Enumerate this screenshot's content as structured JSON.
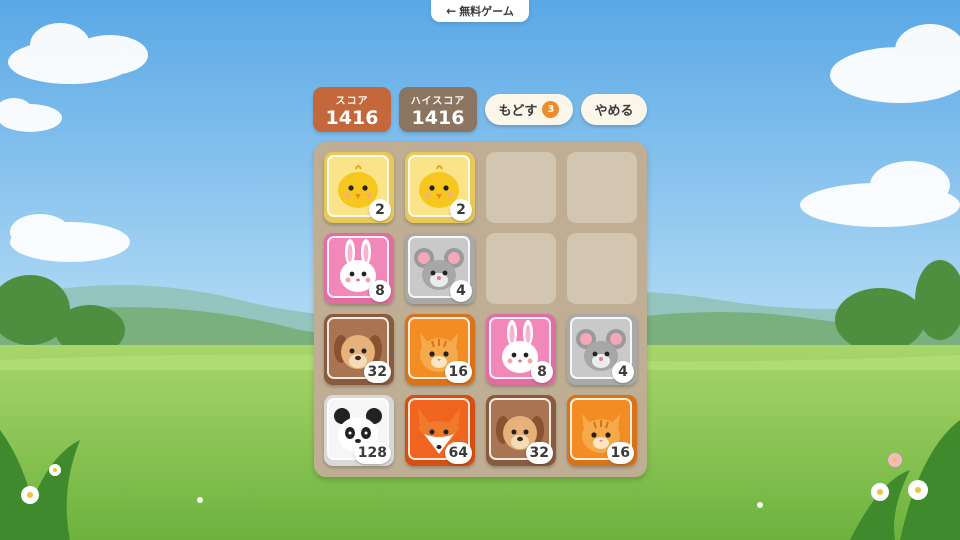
{
  "nav": {
    "back_label": "無料ゲーム",
    "back_icon": "left-arrow-icon"
  },
  "scores": {
    "score_label": "スコア",
    "score_value": "1416",
    "best_label": "ハイスコア",
    "best_value": "1416"
  },
  "controls": {
    "undo_label": "もどす",
    "undo_count": "3",
    "quit_label": "やめる"
  },
  "colors": {
    "score": "#c4673b",
    "best": "#8b7560",
    "board": "#bfae94",
    "empty_cell": "#d2c6b1",
    "undo_badge": "#ef8a2d"
  },
  "board": {
    "rows": [
      [
        {
          "value": "2",
          "animal": "chick"
        },
        {
          "value": "2",
          "animal": "chick"
        },
        null,
        null
      ],
      [
        {
          "value": "8",
          "animal": "rabbit"
        },
        {
          "value": "4",
          "animal": "mouse"
        },
        null,
        null
      ],
      [
        {
          "value": "32",
          "animal": "dog"
        },
        {
          "value": "16",
          "animal": "cat"
        },
        {
          "value": "8",
          "animal": "rabbit"
        },
        {
          "value": "4",
          "animal": "mouse"
        }
      ],
      [
        {
          "value": "128",
          "animal": "panda"
        },
        {
          "value": "64",
          "animal": "fox"
        },
        {
          "value": "32",
          "animal": "dog"
        },
        {
          "value": "16",
          "animal": "cat"
        }
      ]
    ]
  }
}
